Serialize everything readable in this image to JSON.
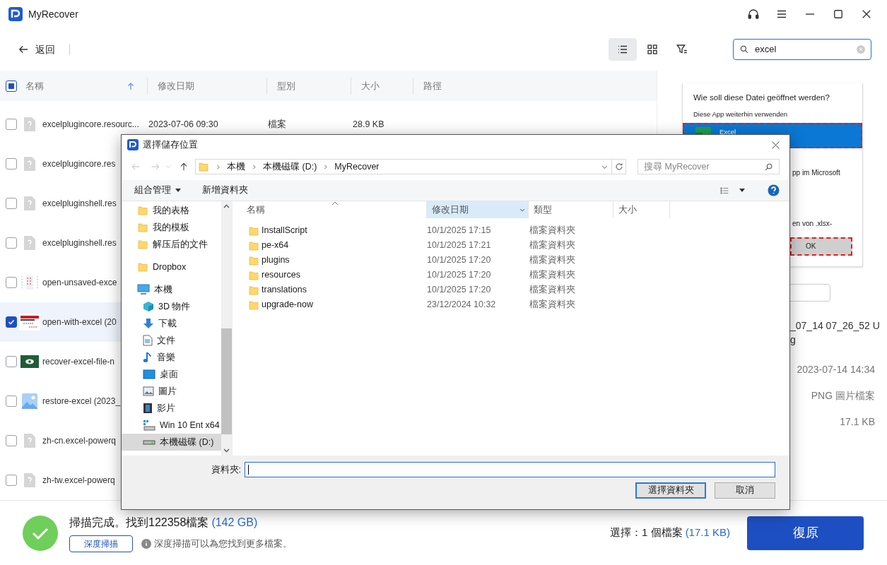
{
  "app": {
    "title": "MyRecover"
  },
  "toolbar": {
    "back": "返回",
    "views": [
      {
        "kind": "list",
        "selected": true
      },
      {
        "kind": "grid",
        "selected": false
      },
      {
        "kind": "filter",
        "selected": false
      }
    ],
    "search": {
      "value": "excel"
    }
  },
  "table": {
    "header_checkbox": {
      "indeterminate": true
    },
    "columns": [
      {
        "label": "名稱",
        "sorted": true
      },
      {
        "label": "修改日期",
        "sorted": false
      },
      {
        "label": "型別",
        "sorted": false
      },
      {
        "label": "大小",
        "sorted": false
      },
      {
        "label": "路徑",
        "sorted": false
      }
    ],
    "rows": [
      {
        "kind": "unknown",
        "name": "excelplugincore.resourc...",
        "date": "2023-07-06 09:30",
        "type": "檔案",
        "size": "28.9 KB",
        "checked": false
      },
      {
        "kind": "unknown",
        "name": "excelplugincore.res",
        "checked": false
      },
      {
        "kind": "unknown",
        "name": "excelpluginshell.res",
        "checked": false
      },
      {
        "kind": "unknown",
        "name": "excelpluginshell.res",
        "checked": false
      },
      {
        "kind": "doc-thumb",
        "name": "open-unsaved-exce",
        "checked": false
      },
      {
        "kind": "web-thumb",
        "name": "open-with-excel (20",
        "checked": true
      },
      {
        "kind": "green-thumb",
        "name": "recover-excel-file-n",
        "checked": false
      },
      {
        "kind": "image",
        "name": "restore-excel (2023_",
        "checked": false
      },
      {
        "kind": "unknown",
        "name": "zh-cn.excel-powerq",
        "checked": false
      },
      {
        "kind": "unknown",
        "name": "zh-tw.excel-powerq",
        "checked": false
      }
    ]
  },
  "preview": {
    "title": "Wie soll diese Datei geöffnet werden?",
    "subtitle": "Diese App weiterhin verwenden",
    "app": "Excel",
    "line_1": "pp im Microsoft",
    "line_2": "en von .xlsx-",
    "ok": "OK"
  },
  "details": {
    "filename": [
      "_07_14 07_26_52 U",
      "g"
    ],
    "date": "2023-07-14 14:34",
    "type": "PNG 圖片檔案",
    "size": "17.1 KB"
  },
  "status": {
    "message": "掃描完成。找到122358檔案",
    "total": "(142 GB)",
    "deep_scan": "深度掃描",
    "hint": "深度掃描可以為您找到更多檔案。",
    "selection": "選擇：1 個檔案",
    "selection_size": "(17.1 KB)",
    "restore": "復原"
  },
  "dialog": {
    "title": "選擇儲存位置",
    "path": [
      "本機",
      "本機磁碟 (D:)",
      "MyRecover"
    ],
    "search_placeholder": "搜尋 MyRecover",
    "commands": [
      {
        "label": "組合管理",
        "dropdown": true
      },
      {
        "label": "新增資料夾",
        "dropdown": false
      }
    ],
    "nav": [
      {
        "children": [
          {
            "kind": "folder",
            "label": "我的表格",
            "selected": false
          },
          {
            "kind": "folder",
            "label": "我的模板",
            "selected": false
          },
          {
            "kind": "folder",
            "label": "解压后的文件",
            "selected": false
          }
        ]
      },
      {
        "kind": "folder",
        "label": "Dropbox",
        "selected": false
      },
      {
        "kind": "pc",
        "label": "本機",
        "selected": false,
        "children": [
          {
            "kind": "cube",
            "label": "3D 物件",
            "selected": false
          },
          {
            "kind": "download",
            "label": "下載",
            "selected": false
          },
          {
            "kind": "document",
            "label": "文件",
            "selected": false
          },
          {
            "kind": "music",
            "label": "音樂",
            "selected": false
          },
          {
            "kind": "desktop",
            "label": "桌面",
            "selected": false
          },
          {
            "kind": "pictures",
            "label": "圖片",
            "selected": false
          },
          {
            "kind": "video",
            "label": "影片",
            "selected": false
          },
          {
            "kind": "win-drive",
            "label": "Win 10 Ent x64",
            "selected": false
          },
          {
            "kind": "drive",
            "label": "本機磁碟 (D:)",
            "selected": true
          }
        ]
      }
    ],
    "columns": [
      {
        "label": "名稱",
        "selected": false
      },
      {
        "label": "修改日期",
        "selected": true
      },
      {
        "label": "類型",
        "selected": false
      },
      {
        "label": "大小",
        "selected": false
      }
    ],
    "files": [
      {
        "name": "InstallScript",
        "date": "10/1/2025 17:15",
        "type": "檔案資料夾"
      },
      {
        "name": "pe-x64",
        "date": "10/1/2025 17:21",
        "type": "檔案資料夾"
      },
      {
        "name": "plugins",
        "date": "10/1/2025 17:20",
        "type": "檔案資料夾"
      },
      {
        "name": "resources",
        "date": "10/1/2025 17:20",
        "type": "檔案資料夾"
      },
      {
        "name": "translations",
        "date": "10/1/2025 17:20",
        "type": "檔案資料夾"
      },
      {
        "name": "upgrade-now",
        "date": "23/12/2024 10:32",
        "type": "檔案資料夾"
      }
    ],
    "folder_label": "資料夾:",
    "confirm": "選擇資料夾",
    "cancel": "取消"
  }
}
